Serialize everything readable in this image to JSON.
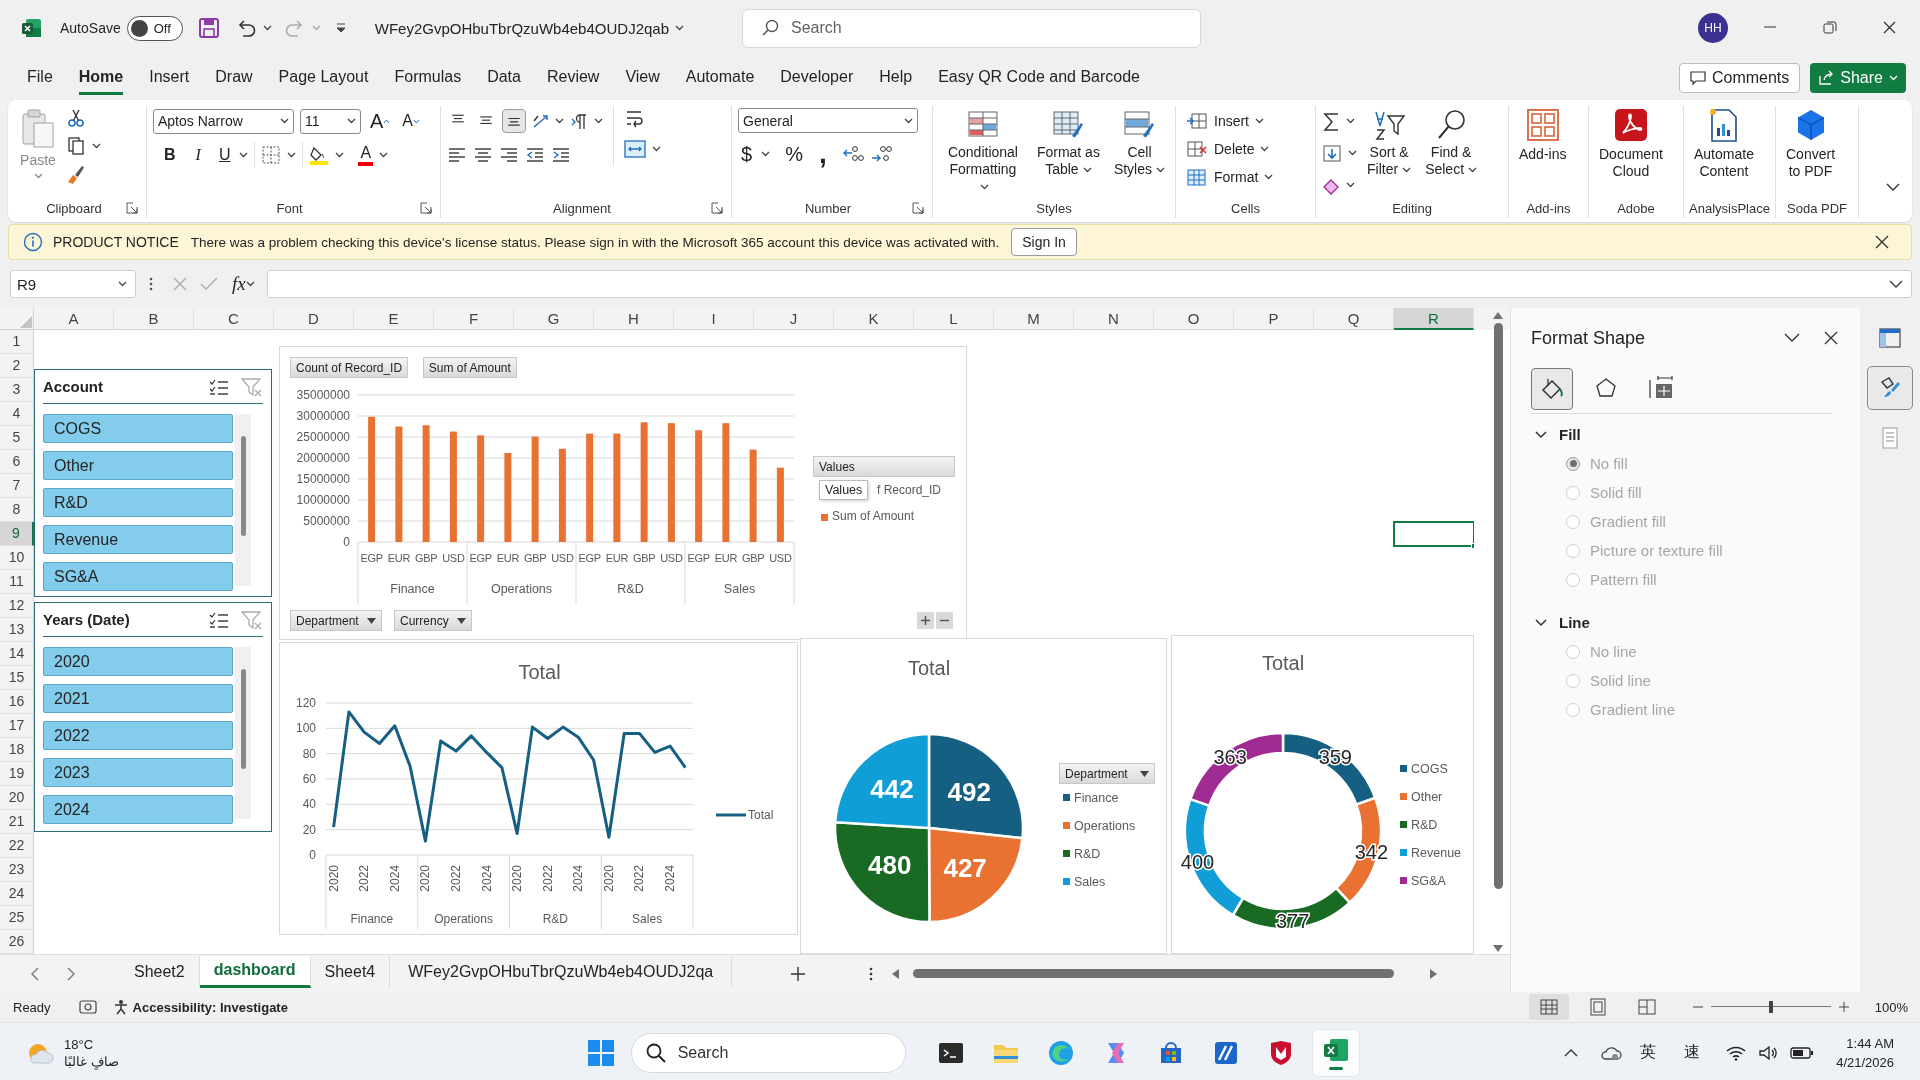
{
  "window": {
    "title": "WFey2GvpOHbuTbrQzuWb4eb4OUDJ2qab",
    "autosave_label": "AutoSave",
    "autosave": {
      "label": "Off",
      "on": false
    },
    "search_placeholder": "Search",
    "user_initials": "HH"
  },
  "menu_tabs": [
    {
      "label": "File",
      "selected": false
    },
    {
      "label": "Home",
      "selected": true
    },
    {
      "label": "Insert",
      "selected": false
    },
    {
      "label": "Draw",
      "selected": false
    },
    {
      "label": "Page Layout",
      "selected": false
    },
    {
      "label": "Formulas",
      "selected": false
    },
    {
      "label": "Data",
      "selected": false
    },
    {
      "label": "Review",
      "selected": false
    },
    {
      "label": "View",
      "selected": false
    },
    {
      "label": "Automate",
      "selected": false
    },
    {
      "label": "Developer",
      "selected": false
    },
    {
      "label": "Help",
      "selected": false
    },
    {
      "label": "Easy QR Code and Barcode",
      "selected": false
    }
  ],
  "comments_button": "Comments",
  "share_button": "Share",
  "ribbon": {
    "groups": [
      {
        "kind": "clipboard",
        "name": "Clipboard",
        "paste": "Paste"
      },
      {
        "kind": "font",
        "name": "Font",
        "font": "Aptos Narrow",
        "size": "11",
        "grow": "A",
        "shrink": "A",
        "bold": "B",
        "italic": "I",
        "underline": "U",
        "font_color": "A"
      },
      {
        "kind": "alignment",
        "name": "Alignment",
        "vertical": [
          {
            "kind": "top",
            "selected": false
          },
          {
            "kind": "middle",
            "selected": false
          },
          {
            "kind": "bottom",
            "selected": true
          }
        ]
      },
      {
        "kind": "number",
        "name": "Number",
        "format": "General",
        "currency": "$",
        "percent": "%",
        "comma": ","
      },
      {
        "kind": "styles",
        "name": "Styles",
        "buttons": [
          {
            "kind": "conditional",
            "label": "Conditional\nFormatting",
            "dropdown": true
          },
          {
            "kind": "table",
            "label": "Format as\nTable",
            "dropdown": true
          },
          {
            "kind": "cellstyles",
            "label": "Cell\nStyles",
            "dropdown": true
          }
        ]
      },
      {
        "kind": "cells",
        "name": "Cells",
        "buttons": [
          {
            "kind": "insert",
            "label": "Insert",
            "dropdown": true
          },
          {
            "kind": "delete",
            "label": "Delete",
            "dropdown": true
          },
          {
            "kind": "format",
            "label": "Format",
            "dropdown": true
          }
        ]
      },
      {
        "kind": "editing",
        "name": "Editing",
        "buttons": [
          {
            "kind": "sort",
            "label": "Sort &\nFilter",
            "dropdown": true
          },
          {
            "kind": "find",
            "label": "Find &\nSelect",
            "dropdown": true
          }
        ]
      },
      {
        "kind": "addins",
        "name": "Add-ins",
        "buttons": [
          {
            "kind": "addins",
            "label": "Add-ins",
            "dropdown": false
          }
        ]
      },
      {
        "kind": "adobe",
        "name": "Adobe",
        "buttons": [
          {
            "kind": "pdfcloud",
            "label": "Document\nCloud",
            "dropdown": false
          }
        ]
      },
      {
        "kind": "analysis",
        "name": "AnalysisPlace",
        "buttons": [
          {
            "kind": "automate",
            "label": "Automate\nContent",
            "dropdown": false
          }
        ]
      },
      {
        "kind": "soda",
        "name": "Soda PDF",
        "buttons": [
          {
            "kind": "convert",
            "label": "Convert\nto PDF",
            "dropdown": false
          }
        ]
      }
    ]
  },
  "notice": {
    "title": "PRODUCT NOTICE",
    "message": "There was a problem checking this device's license status. Please sign in with the Microsoft 365 account this device was activated with.",
    "button": "Sign In"
  },
  "formula_bar": {
    "name_box": "R9",
    "fx_label": "fx"
  },
  "sheet": {
    "columns": [
      {
        "label": "A",
        "selected": false
      },
      {
        "label": "B",
        "selected": false
      },
      {
        "label": "C",
        "selected": false
      },
      {
        "label": "D",
        "selected": false
      },
      {
        "label": "E",
        "selected": false
      },
      {
        "label": "F",
        "selected": false
      },
      {
        "label": "G",
        "selected": false
      },
      {
        "label": "H",
        "selected": false
      },
      {
        "label": "I",
        "selected": false
      },
      {
        "label": "J",
        "selected": false
      },
      {
        "label": "K",
        "selected": false
      },
      {
        "label": "L",
        "selected": false
      },
      {
        "label": "M",
        "selected": false
      },
      {
        "label": "N",
        "selected": false
      },
      {
        "label": "O",
        "selected": false
      },
      {
        "label": "P",
        "selected": false
      },
      {
        "label": "Q",
        "selected": false
      },
      {
        "label": "R",
        "selected": true
      }
    ],
    "rows": [
      {
        "label": "1",
        "selected": false
      },
      {
        "label": "2",
        "selected": false
      },
      {
        "label": "3",
        "selected": false
      },
      {
        "label": "4",
        "selected": false
      },
      {
        "label": "5",
        "selected": false
      },
      {
        "label": "6",
        "selected": false
      },
      {
        "label": "7",
        "selected": false
      },
      {
        "label": "8",
        "selected": false
      },
      {
        "label": "9",
        "selected": true
      },
      {
        "label": "10",
        "selected": false
      },
      {
        "label": "11",
        "selected": false
      },
      {
        "label": "12",
        "selected": false
      },
      {
        "label": "13",
        "selected": false
      },
      {
        "label": "14",
        "selected": false
      },
      {
        "label": "15",
        "selected": false
      },
      {
        "label": "16",
        "selected": false
      },
      {
        "label": "17",
        "selected": false
      },
      {
        "label": "18",
        "selected": false
      },
      {
        "label": "19",
        "selected": false
      },
      {
        "label": "20",
        "selected": false
      },
      {
        "label": "21",
        "selected": false
      },
      {
        "label": "22",
        "selected": false
      },
      {
        "label": "23",
        "selected": false
      },
      {
        "label": "24",
        "selected": false
      },
      {
        "label": "25",
        "selected": false
      },
      {
        "label": "26",
        "selected": false
      }
    ],
    "slicers": [
      {
        "title": "Account",
        "items": [
          {
            "label": "COGS",
            "selected": true
          },
          {
            "label": "Other",
            "selected": true
          },
          {
            "label": "R&D",
            "selected": true
          },
          {
            "label": "Revenue",
            "selected": true
          },
          {
            "label": "SG&A",
            "selected": true
          }
        ]
      },
      {
        "title": "Years (Date)",
        "items": [
          {
            "label": "2020",
            "selected": true
          },
          {
            "label": "2021",
            "selected": true
          },
          {
            "label": "2022",
            "selected": true
          },
          {
            "label": "2023",
            "selected": true
          },
          {
            "label": "2024",
            "selected": true
          }
        ]
      }
    ],
    "pivot_chart": {
      "field_buttons": [
        "Count of Record_ID",
        "Sum of Amount"
      ],
      "axis_buttons": [
        "Department",
        "Currency"
      ],
      "groups": [
        "Finance",
        "Operations",
        "R&D",
        "Sales"
      ],
      "legend_title": "Values",
      "legend_partial_item": "f Record_ID",
      "tooltip": "Values",
      "chart_data": {
        "type": "bar",
        "legend": "right",
        "categories": [
          "EGP",
          "EUR",
          "GBP",
          "USD",
          "EGP",
          "EUR",
          "GBP",
          "USD",
          "EGP",
          "EUR",
          "GBP",
          "USD",
          "EGP",
          "EUR",
          "GBP",
          "USD"
        ],
        "series": [
          {
            "name": "Sum of Amount",
            "color": "#e97132",
            "values": [
              29800000,
              27500000,
              27800000,
              26300000,
              25400000,
              21200000,
              25100000,
              22200000,
              25800000,
              25800000,
              28500000,
              28300000,
              26600000,
              28300000,
              22000000,
              17700000
            ]
          }
        ],
        "grid": true,
        "ylim": [
          0,
          35000000
        ],
        "yticks": [
          0,
          5000000,
          10000000,
          15000000,
          20000000,
          25000000,
          30000000,
          35000000
        ]
      }
    },
    "line_chart": {
      "groups": [
        "Finance",
        "Operations",
        "R&D",
        "Sales"
      ],
      "chart_data": {
        "type": "line",
        "title": "Total",
        "legend": "right",
        "series": [
          {
            "name": "Total",
            "color": "#156082",
            "values": [
              22,
              113,
              97,
              88,
              102,
              70,
              11,
              90,
              82,
              94,
              81,
              69,
              17,
              101,
              92,
              101,
              93,
              75,
              14,
              96,
              96,
              81,
              86,
              69
            ]
          }
        ],
        "categories": [
          "2020",
          null,
          "2022",
          null,
          "2024",
          null,
          "2020",
          null,
          "2022",
          null,
          "2024",
          null,
          "2020",
          null,
          "2022",
          null,
          "2024",
          null,
          "2020",
          null,
          "2022",
          null,
          "2024",
          null
        ],
        "grid": true,
        "ylim": [
          0,
          120
        ],
        "yticks": [
          0,
          20,
          40,
          60,
          80,
          100,
          120
        ]
      }
    },
    "pie_chart": {
      "legend_button": "Department",
      "slices": [
        {
          "color": "#156082"
        },
        {
          "color": "#e97132"
        },
        {
          "color": "#196b24"
        },
        {
          "color": "#0f9ed5"
        }
      ],
      "chart_data": {
        "type": "pie",
        "title": "Total",
        "data_labels": true,
        "legend": "right",
        "categories": [
          "Finance",
          "Operations",
          "R&D",
          "Sales"
        ],
        "series": [
          {
            "values": [
              492,
              427,
              480,
              442
            ]
          }
        ]
      }
    },
    "donut_chart": {
      "slices": [
        {
          "color": "#156082"
        },
        {
          "color": "#e97132"
        },
        {
          "color": "#196b24"
        },
        {
          "color": "#0f9ed5"
        },
        {
          "color": "#a02b93"
        }
      ],
      "chart_data": {
        "type": "donut",
        "title": "Total",
        "data_labels": true,
        "legend": "right",
        "categories": [
          "COGS",
          "Other",
          "R&D",
          "Revenue",
          "SG&A"
        ],
        "series": [
          {
            "values": [
              359,
              342,
              377,
              400,
              363
            ]
          }
        ]
      }
    }
  },
  "format_pane": {
    "title": "Format Shape",
    "tabs": [
      {
        "kind": "fill_line",
        "selected": true
      },
      {
        "kind": "effects",
        "selected": false
      },
      {
        "kind": "size",
        "selected": false
      }
    ],
    "sections": [
      {
        "title": "Fill",
        "expanded": true,
        "options": [
          {
            "label": "No fill",
            "selected": true,
            "disabled": true
          },
          {
            "label": "Solid fill",
            "selected": false,
            "disabled": true
          },
          {
            "label": "Gradient fill",
            "selected": false,
            "disabled": true
          },
          {
            "label": "Picture or texture fill",
            "selected": false,
            "disabled": true
          },
          {
            "label": "Pattern fill",
            "selected": false,
            "disabled": true
          }
        ]
      },
      {
        "title": "Line",
        "expanded": true,
        "options": [
          {
            "label": "No line",
            "selected": false,
            "disabled": true
          },
          {
            "label": "Solid line",
            "selected": false,
            "disabled": true
          },
          {
            "label": "Gradient line",
            "selected": false,
            "disabled": true
          }
        ]
      }
    ]
  },
  "side_strip": {
    "buttons": [
      {
        "kind": "layout",
        "selected": false
      },
      {
        "kind": "format",
        "selected": true
      },
      {
        "kind": "document",
        "selected": false
      }
    ]
  },
  "sheet_tabs": [
    {
      "label": "Sheet2",
      "selected": false
    },
    {
      "label": "dashboard",
      "selected": true
    },
    {
      "label": "Sheet4",
      "selected": false
    },
    {
      "label": "WFey2GvpOHbuTbrQzuWb4eb4OUDJ2qa",
      "selected": false
    }
  ],
  "status_bar": {
    "mode": "Ready",
    "accessibility": "Accessibility: Investigate",
    "views": [
      {
        "kind": "normal",
        "selected": true
      },
      {
        "kind": "page_layout",
        "selected": false
      },
      {
        "kind": "page_break",
        "selected": false
      }
    ],
    "zoom": {
      "level": 0.5,
      "label": "100%"
    }
  },
  "taskbar": {
    "weather": {
      "temperature": "18°C",
      "condition": "صافٍ غالبًا"
    },
    "search_placeholder": "Search",
    "apps": [
      {
        "kind": "terminal",
        "active": false
      },
      {
        "kind": "folder",
        "active": false
      },
      {
        "kind": "browser",
        "active": false
      },
      {
        "kind": "copilot",
        "active": false
      },
      {
        "kind": "store",
        "active": false
      },
      {
        "kind": "editor",
        "active": false
      },
      {
        "kind": "shield",
        "active": false
      },
      {
        "kind": "excel",
        "active": true
      }
    ],
    "tray": {
      "input_language": "英",
      "input_mode": "速",
      "time": "1:44 AM",
      "date": "4/21/2026"
    }
  }
}
